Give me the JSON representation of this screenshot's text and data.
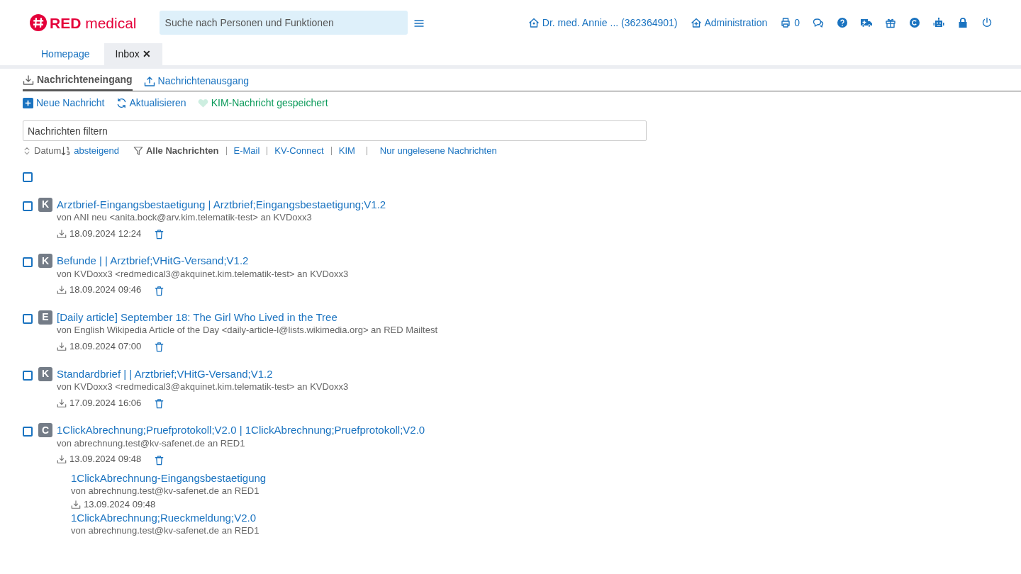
{
  "header": {
    "logo": {
      "brand": "RED",
      "product": "medical"
    },
    "search": {
      "placeholder": "Suche nach Personen und Funktionen"
    },
    "user": "Dr. med. Annie ... (362364901)",
    "admin": "Administration",
    "print_count": "0"
  },
  "tabs": [
    {
      "label": "Homepage",
      "selected": false,
      "closable": false
    },
    {
      "label": "Inbox",
      "selected": true,
      "closable": true,
      "close": "✕"
    }
  ],
  "subtabs": [
    {
      "label": "Nachrichteneingang",
      "kind": "inbox",
      "selected": true
    },
    {
      "label": "Nachrichtenausgang",
      "kind": "outbox",
      "selected": false
    }
  ],
  "actions": [
    {
      "label": "Neue Nachricht",
      "kind": "new"
    },
    {
      "label": "Aktualisieren",
      "kind": "refresh"
    },
    {
      "label": "KIM-Nachricht gespeichert",
      "kind": "saved"
    }
  ],
  "filter": {
    "placeholder": "Nachrichten filtern",
    "sort_label": "Datum",
    "sort_order": "absteigend",
    "sources": [
      {
        "label": "Alle Nachrichten",
        "selected": true
      },
      {
        "label": "E-Mail",
        "selected": false
      },
      {
        "label": "KV-Connect",
        "selected": false
      },
      {
        "label": "KIM",
        "selected": false
      }
    ],
    "unread_only": {
      "label": "Nur ungelesene Nachrichten",
      "selected": false
    }
  },
  "select_all": {
    "checked": false
  },
  "messages": [
    {
      "type": "K",
      "subject": "Arztbrief-Eingangsbestaetigung | Arztbrief;Eingangsbestaetigung;V1.2",
      "from": "von ANI neu <anita.bock@arv.kim.telematik-test> an KVDoxx3",
      "date": "18.09.2024 12:24",
      "checked": false
    },
    {
      "type": "K",
      "subject": "Befunde | | Arztbrief;VHitG-Versand;V1.2",
      "from": "von KVDoxx3 <redmedical3@akquinet.kim.telematik-test> an KVDoxx3",
      "date": "18.09.2024 09:46",
      "checked": false
    },
    {
      "type": "E",
      "subject": "[Daily article] September 18: The Girl Who Lived in the Tree",
      "from": "von English Wikipedia Article of the Day <daily-article-l@lists.wikimedia.org> an RED Mailtest",
      "date": "18.09.2024 07:00",
      "checked": false
    },
    {
      "type": "K",
      "subject": "Standardbrief | | Arztbrief;VHitG-Versand;V1.2",
      "from": "von KVDoxx3 <redmedical3@akquinet.kim.telematik-test> an KVDoxx3",
      "date": "17.09.2024 16:06",
      "checked": false
    },
    {
      "type": "C",
      "subject": "1ClickAbrechnung;Pruefprotokoll;V2.0 | 1ClickAbrechnung;Pruefprotokoll;V2.0",
      "from": "von abrechnung.test@kv-safenet.de an RED1",
      "date": "13.09.2024 09:48",
      "checked": false,
      "children": [
        {
          "subject": "1ClickAbrechnung-Eingangsbestaetigung",
          "from": "von abrechnung.test@kv-safenet.de an RED1",
          "date": "13.09.2024 09:48"
        },
        {
          "subject": "1ClickAbrechnung;Rueckmeldung;V2.0",
          "from": "von abrechnung.test@kv-safenet.de an RED1"
        }
      ]
    }
  ]
}
